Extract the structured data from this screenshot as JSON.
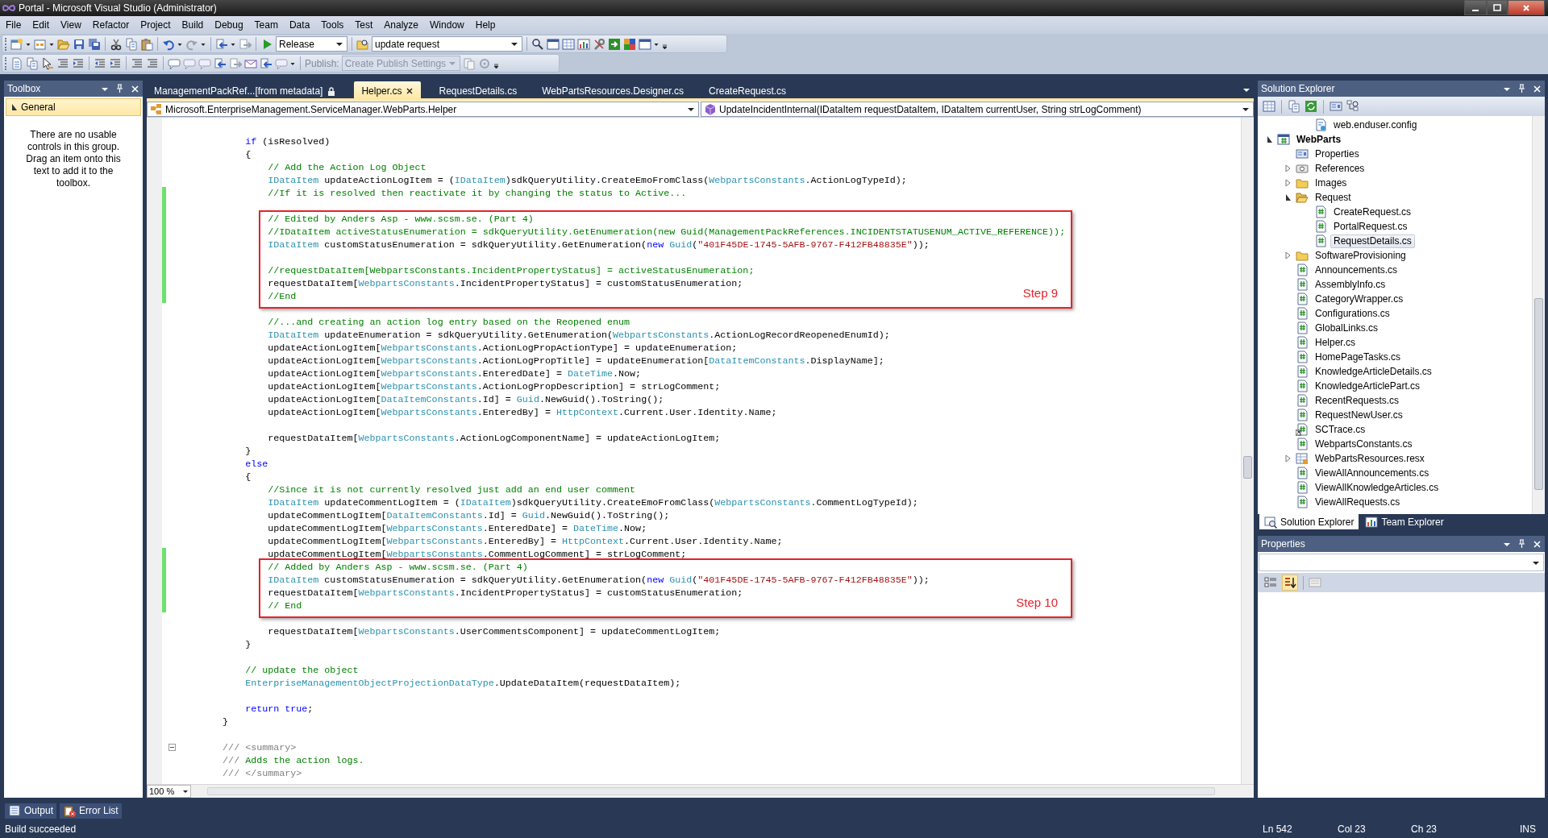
{
  "window": {
    "title": "Portal - Microsoft Visual Studio (Administrator)"
  },
  "menu": [
    "File",
    "Edit",
    "View",
    "Refactor",
    "Project",
    "Build",
    "Debug",
    "Team",
    "Data",
    "Tools",
    "Test",
    "Analyze",
    "Window",
    "Help"
  ],
  "toolbar": {
    "configuration": "Release",
    "find_box": "update request",
    "publish_label": "Publish:",
    "publish_profile": {
      "text": "Create Publish Settings",
      "disabled": true
    }
  },
  "toolbox": {
    "title": "Toolbox",
    "group": {
      "label": "General",
      "expanded": true
    },
    "message": "There are no usable controls in this group. Drag an item onto this text to add it to the toolbox."
  },
  "editor": {
    "tabs": [
      {
        "label": "ManagementPackRef...[from metadata]",
        "selected": false,
        "locked": true
      },
      {
        "label": "Helper.cs",
        "selected": true,
        "locked": false
      },
      {
        "label": "RequestDetails.cs",
        "selected": false,
        "locked": false
      },
      {
        "label": "WebPartsResources.Designer.cs",
        "selected": false,
        "locked": false
      },
      {
        "label": "CreateRequest.cs",
        "selected": false,
        "locked": false
      }
    ],
    "type_dropdown": "Microsoft.EnterpriseManagement.ServiceManager.WebParts.Helper",
    "member_dropdown": "UpdateIncidentInternal(IDataItem requestDataItem, IDataItem currentUser, String strLogComment)",
    "blocks": [
      {
        "kind": "plain",
        "lines": [
          {
            "changed": false
          },
          {
            "changed": false,
            "tokens": [
              {
                "kind": "keyword",
                "text": "            if"
              },
              {
                "kind": "plain",
                "text": " (isResolved)"
              }
            ]
          },
          {
            "changed": false,
            "tokens": [
              {
                "kind": "plain",
                "text": "            {"
              }
            ]
          },
          {
            "changed": false,
            "tokens": [
              {
                "kind": "comment",
                "text": "                // Add the Action Log Object"
              }
            ]
          },
          {
            "changed": false,
            "tokens": [
              {
                "kind": "type",
                "text": "                IDataItem"
              },
              {
                "kind": "plain",
                "text": " updateActionLogItem = ("
              },
              {
                "kind": "type",
                "text": "IDataItem"
              },
              {
                "kind": "plain",
                "text": ")sdkQueryUtility.CreateEmoFromClass("
              },
              {
                "kind": "type",
                "text": "WebpartsConstants"
              },
              {
                "kind": "plain",
                "text": ".ActionLogTypeId);"
              }
            ]
          },
          {
            "changed": true,
            "tokens": [
              {
                "kind": "comment",
                "text": "                //If it is resolved then reactivate it by changing the status to Active..."
              }
            ]
          },
          {
            "changed": true
          }
        ]
      },
      {
        "kind": "highlight",
        "label": "Step 9",
        "lines": [
          {
            "changed": true,
            "tokens": [
              {
                "kind": "comment",
                "text": "                // Edited by Anders Asp - www.scsm.se. (Part 4)"
              }
            ]
          },
          {
            "changed": true,
            "tokens": [
              {
                "kind": "comment",
                "text": "                //IDataItem activeStatusEnumeration = sdkQueryUtility.GetEnumeration(new Guid(ManagementPackReferences.INCIDENTSTATUSENUM_ACTIVE_REFERENCE));"
              }
            ]
          },
          {
            "changed": true,
            "tokens": [
              {
                "kind": "type",
                "text": "                IDataItem"
              },
              {
                "kind": "plain",
                "text": " customStatusEnumeration = sdkQueryUtility.GetEnumeration("
              },
              {
                "kind": "keyword",
                "text": "new"
              },
              {
                "kind": "type",
                "text": " Guid"
              },
              {
                "kind": "plain",
                "text": "("
              },
              {
                "kind": "string",
                "text": "\"401F45DE-1745-5AFB-9767-F412FB48835E\""
              },
              {
                "kind": "plain",
                "text": "));"
              }
            ]
          },
          {
            "changed": true
          },
          {
            "changed": true,
            "tokens": [
              {
                "kind": "comment",
                "text": "                //requestDataItem[WebpartsConstants.IncidentPropertyStatus] = activeStatusEnumeration;"
              }
            ]
          },
          {
            "changed": true,
            "tokens": [
              {
                "kind": "plain",
                "text": "                requestDataItem["
              },
              {
                "kind": "type",
                "text": "WebpartsConstants"
              },
              {
                "kind": "plain",
                "text": ".IncidentPropertyStatus] = customStatusEnumeration;"
              }
            ]
          },
          {
            "changed": true,
            "tokens": [
              {
                "kind": "comment",
                "text": "                //End"
              }
            ]
          }
        ]
      },
      {
        "kind": "plain",
        "lines": [
          {
            "changed": false
          },
          {
            "changed": false,
            "tokens": [
              {
                "kind": "comment",
                "text": "                //...and creating an action log entry based on the Reopened enum"
              }
            ]
          },
          {
            "changed": false,
            "tokens": [
              {
                "kind": "type",
                "text": "                IDataItem"
              },
              {
                "kind": "plain",
                "text": " updateEnumeration = sdkQueryUtility.GetEnumeration("
              },
              {
                "kind": "type",
                "text": "WebpartsConstants"
              },
              {
                "kind": "plain",
                "text": ".ActionLogRecordReopenedEnumId);"
              }
            ]
          },
          {
            "changed": false,
            "tokens": [
              {
                "kind": "plain",
                "text": "                updateActionLogItem["
              },
              {
                "kind": "type",
                "text": "WebpartsConstants"
              },
              {
                "kind": "plain",
                "text": ".ActionLogPropActionType] = updateEnumeration;"
              }
            ]
          },
          {
            "changed": false,
            "tokens": [
              {
                "kind": "plain",
                "text": "                updateActionLogItem["
              },
              {
                "kind": "type",
                "text": "WebpartsConstants"
              },
              {
                "kind": "plain",
                "text": ".ActionLogPropTitle] = updateEnumeration["
              },
              {
                "kind": "type",
                "text": "DataItemConstants"
              },
              {
                "kind": "plain",
                "text": ".DisplayName];"
              }
            ]
          },
          {
            "changed": false,
            "tokens": [
              {
                "kind": "plain",
                "text": "                updateActionLogItem["
              },
              {
                "kind": "type",
                "text": "WebpartsConstants"
              },
              {
                "kind": "plain",
                "text": ".EnteredDate] = "
              },
              {
                "kind": "type",
                "text": "DateTime"
              },
              {
                "kind": "plain",
                "text": ".Now;"
              }
            ]
          },
          {
            "changed": false,
            "tokens": [
              {
                "kind": "plain",
                "text": "                updateActionLogItem["
              },
              {
                "kind": "type",
                "text": "WebpartsConstants"
              },
              {
                "kind": "plain",
                "text": ".ActionLogPropDescription] = strLogComment;"
              }
            ]
          },
          {
            "changed": false,
            "tokens": [
              {
                "kind": "plain",
                "text": "                updateActionLogItem["
              },
              {
                "kind": "type",
                "text": "DataItemConstants"
              },
              {
                "kind": "plain",
                "text": ".Id] = "
              },
              {
                "kind": "type",
                "text": "Guid"
              },
              {
                "kind": "plain",
                "text": ".NewGuid().ToString();"
              }
            ]
          },
          {
            "changed": false,
            "tokens": [
              {
                "kind": "plain",
                "text": "                updateActionLogItem["
              },
              {
                "kind": "type",
                "text": "WebpartsConstants"
              },
              {
                "kind": "plain",
                "text": ".EnteredBy] = "
              },
              {
                "kind": "type",
                "text": "HttpContext"
              },
              {
                "kind": "plain",
                "text": ".Current.User.Identity.Name;"
              }
            ]
          },
          {
            "changed": false
          },
          {
            "changed": false,
            "tokens": [
              {
                "kind": "plain",
                "text": "                requestDataItem["
              },
              {
                "kind": "type",
                "text": "WebpartsConstants"
              },
              {
                "kind": "plain",
                "text": ".ActionLogComponentName] = updateActionLogItem;"
              }
            ]
          },
          {
            "changed": false,
            "tokens": [
              {
                "kind": "plain",
                "text": "            }"
              }
            ]
          },
          {
            "changed": false,
            "tokens": [
              {
                "kind": "keyword",
                "text": "            else"
              }
            ]
          },
          {
            "changed": false,
            "tokens": [
              {
                "kind": "plain",
                "text": "            {"
              }
            ]
          },
          {
            "changed": false,
            "tokens": [
              {
                "kind": "comment",
                "text": "                //Since it is not currently resolved just add an end user comment"
              }
            ]
          },
          {
            "changed": false,
            "tokens": [
              {
                "kind": "type",
                "text": "                IDataItem"
              },
              {
                "kind": "plain",
                "text": " updateCommentLogItem = ("
              },
              {
                "kind": "type",
                "text": "IDataItem"
              },
              {
                "kind": "plain",
                "text": ")sdkQueryUtility.CreateEmoFromClass("
              },
              {
                "kind": "type",
                "text": "WebpartsConstants"
              },
              {
                "kind": "plain",
                "text": ".CommentLogTypeId);"
              }
            ]
          },
          {
            "changed": false,
            "tokens": [
              {
                "kind": "plain",
                "text": "                updateCommentLogItem["
              },
              {
                "kind": "type",
                "text": "DataItemConstants"
              },
              {
                "kind": "plain",
                "text": ".Id] = "
              },
              {
                "kind": "type",
                "text": "Guid"
              },
              {
                "kind": "plain",
                "text": ".NewGuid().ToString();"
              }
            ]
          },
          {
            "changed": false,
            "tokens": [
              {
                "kind": "plain",
                "text": "                updateCommentLogItem["
              },
              {
                "kind": "type",
                "text": "WebpartsConstants"
              },
              {
                "kind": "plain",
                "text": ".EnteredDate] = "
              },
              {
                "kind": "type",
                "text": "DateTime"
              },
              {
                "kind": "plain",
                "text": ".Now;"
              }
            ]
          },
          {
            "changed": false,
            "tokens": [
              {
                "kind": "plain",
                "text": "                updateCommentLogItem["
              },
              {
                "kind": "type",
                "text": "WebpartsConstants"
              },
              {
                "kind": "plain",
                "text": ".EnteredBy] = "
              },
              {
                "kind": "type",
                "text": "HttpContext"
              },
              {
                "kind": "plain",
                "text": ".Current.User.Identity.Name;"
              }
            ]
          },
          {
            "changed": true,
            "tokens": [
              {
                "kind": "plain",
                "text": "                updateCommentLogItem["
              },
              {
                "kind": "type",
                "text": "WebpartsConstants"
              },
              {
                "kind": "plain",
                "text": ".CommentLogComment] = strLogComment;"
              }
            ]
          }
        ]
      },
      {
        "kind": "highlight",
        "label": "Step 10",
        "lines": [
          {
            "changed": true,
            "tokens": [
              {
                "kind": "comment",
                "text": "                // Added by Anders Asp - www.scsm.se. (Part 4)"
              }
            ]
          },
          {
            "changed": true,
            "tokens": [
              {
                "kind": "type",
                "text": "                IDataItem"
              },
              {
                "kind": "plain",
                "text": " customStatusEnumeration = sdkQueryUtility.GetEnumeration("
              },
              {
                "kind": "keyword",
                "text": "new"
              },
              {
                "kind": "type",
                "text": " Guid"
              },
              {
                "kind": "plain",
                "text": "("
              },
              {
                "kind": "string",
                "text": "\"401F45DE-1745-5AFB-9767-F412FB48835E\""
              },
              {
                "kind": "plain",
                "text": "));"
              }
            ]
          },
          {
            "changed": true,
            "tokens": [
              {
                "kind": "plain",
                "text": "                requestDataItem["
              },
              {
                "kind": "type",
                "text": "WebpartsConstants"
              },
              {
                "kind": "plain",
                "text": ".IncidentPropertyStatus] = customStatusEnumeration;"
              }
            ]
          },
          {
            "changed": true,
            "tokens": [
              {
                "kind": "comment",
                "text": "                // End"
              }
            ]
          }
        ]
      },
      {
        "kind": "plain",
        "lines": [
          {
            "changed": false
          },
          {
            "changed": false,
            "tokens": [
              {
                "kind": "plain",
                "text": "                requestDataItem["
              },
              {
                "kind": "type",
                "text": "WebpartsConstants"
              },
              {
                "kind": "plain",
                "text": ".UserCommentsComponent] = updateCommentLogItem;"
              }
            ]
          },
          {
            "changed": false,
            "tokens": [
              {
                "kind": "plain",
                "text": "            }"
              }
            ]
          },
          {
            "changed": false
          },
          {
            "changed": false,
            "tokens": [
              {
                "kind": "comment",
                "text": "            // update the object"
              }
            ]
          },
          {
            "changed": false,
            "tokens": [
              {
                "kind": "type",
                "text": "            EnterpriseManagementObjectProjectionDataType"
              },
              {
                "kind": "plain",
                "text": ".UpdateDataItem(requestDataItem);"
              }
            ]
          },
          {
            "changed": false
          },
          {
            "changed": false,
            "tokens": [
              {
                "kind": "keyword",
                "text": "            return true"
              },
              {
                "kind": "plain",
                "text": ";"
              }
            ]
          },
          {
            "changed": false,
            "tokens": [
              {
                "kind": "plain",
                "text": "        }"
              }
            ]
          },
          {
            "changed": false
          }
        ]
      },
      {
        "kind": "summary",
        "lines": [
          {
            "changed": false,
            "tokens": [
              {
                "kind": "doc",
                "text": "        /// <summary>"
              }
            ]
          },
          {
            "changed": false,
            "tokens": [
              {
                "kind": "doc",
                "text": "        ///"
              },
              {
                "kind": "comment",
                "text": " Adds the action logs."
              }
            ]
          },
          {
            "changed": false,
            "tokens": [
              {
                "kind": "doc",
                "text": "        /// </summary>"
              }
            ]
          }
        ]
      }
    ],
    "zoom": "100 %"
  },
  "solution_explorer": {
    "title": "Solution Explorer",
    "hidden_project_items": [
      {
        "label": "web.enduser.config",
        "kind": "config",
        "selected": false
      }
    ],
    "tree": [
      {
        "label": "WebParts",
        "kind": "project",
        "expanded": true,
        "selected": false,
        "children": [
          {
            "label": "Properties",
            "kind": "properties",
            "selected": false
          },
          {
            "label": "References",
            "kind": "references",
            "expanded": false,
            "selected": false
          },
          {
            "label": "Images",
            "kind": "folder",
            "expanded": false,
            "selected": false
          },
          {
            "label": "Request",
            "kind": "folder",
            "expanded": true,
            "selected": false,
            "children": [
              {
                "label": "CreateRequest.cs",
                "kind": "cs",
                "selected": false
              },
              {
                "label": "PortalRequest.cs",
                "kind": "cs",
                "selected": false
              },
              {
                "label": "RequestDetails.cs",
                "kind": "cs",
                "selected": true
              }
            ]
          },
          {
            "label": "SoftwareProvisioning",
            "kind": "folder",
            "expanded": false,
            "selected": false
          },
          {
            "label": "Announcements.cs",
            "kind": "cs",
            "selected": false
          },
          {
            "label": "AssemblyInfo.cs",
            "kind": "cs",
            "selected": false
          },
          {
            "label": "CategoryWrapper.cs",
            "kind": "cs",
            "selected": false
          },
          {
            "label": "Configurations.cs",
            "kind": "cs",
            "selected": false
          },
          {
            "label": "GlobalLinks.cs",
            "kind": "cs",
            "selected": false
          },
          {
            "label": "Helper.cs",
            "kind": "cs",
            "selected": false
          },
          {
            "label": "HomePageTasks.cs",
            "kind": "cs",
            "selected": false
          },
          {
            "label": "KnowledgeArticleDetails.cs",
            "kind": "cs",
            "selected": false
          },
          {
            "label": "KnowledgeArticlePart.cs",
            "kind": "cs",
            "selected": false
          },
          {
            "label": "RecentRequests.cs",
            "kind": "cs",
            "selected": false
          },
          {
            "label": "RequestNewUser.cs",
            "kind": "cs",
            "selected": false
          },
          {
            "label": "SCTrace.cs",
            "kind": "cs-link",
            "selected": false
          },
          {
            "label": "WebpartsConstants.cs",
            "kind": "cs",
            "selected": false
          },
          {
            "label": "WebPartsResources.resx",
            "kind": "resx",
            "expanded": false,
            "selected": false
          },
          {
            "label": "ViewAllAnnouncements.cs",
            "kind": "cs",
            "selected": false
          },
          {
            "label": "ViewAllKnowledgeArticles.cs",
            "kind": "cs",
            "selected": false
          },
          {
            "label": "ViewAllRequests.cs",
            "kind": "cs",
            "selected": false
          }
        ]
      }
    ],
    "tabs": [
      {
        "label": "Solution Explorer",
        "selected": true
      },
      {
        "label": "Team Explorer",
        "selected": false
      }
    ]
  },
  "properties": {
    "title": "Properties",
    "alphabetical": true
  },
  "output_tabs": [
    "Output",
    "Error List"
  ],
  "status_bar": {
    "message": "Build succeeded",
    "line": "Ln 542",
    "column": "Col 23",
    "char": "Ch 23",
    "mode": "INS"
  }
}
